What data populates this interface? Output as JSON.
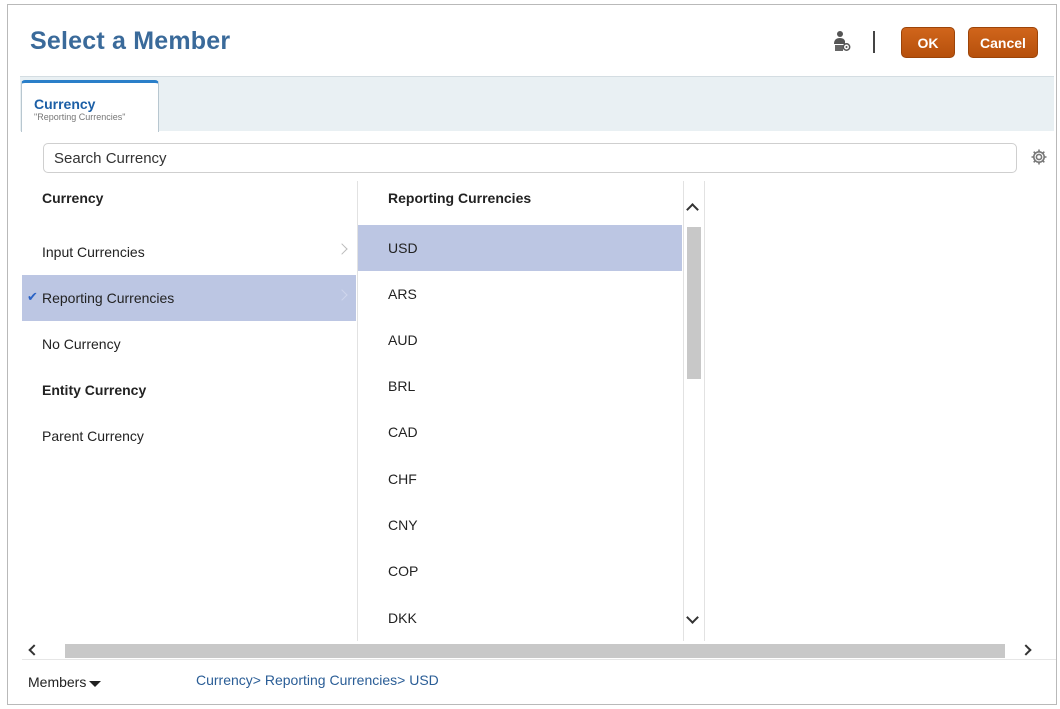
{
  "dialog": {
    "title": "Select a Member",
    "ok_label": "OK",
    "cancel_label": "Cancel",
    "accent_color": "#c95d14"
  },
  "tab": {
    "title": "Currency",
    "subtitle": "\"Reporting Currencies\""
  },
  "search": {
    "placeholder": "Search Currency"
  },
  "column1": {
    "header": "Currency",
    "items": [
      {
        "label": "Input Currencies",
        "bold": false,
        "has_children": true,
        "selected": false
      },
      {
        "label": "Reporting Currencies",
        "bold": false,
        "has_children": true,
        "selected": true,
        "checked": true
      },
      {
        "label": "No Currency",
        "bold": false,
        "has_children": false,
        "selected": false
      },
      {
        "label": "Entity Currency",
        "bold": true,
        "has_children": false,
        "selected": false
      },
      {
        "label": "Parent Currency",
        "bold": false,
        "has_children": false,
        "selected": false
      }
    ]
  },
  "column2": {
    "header": "Reporting Currencies",
    "items": [
      {
        "label": "USD",
        "selected": true
      },
      {
        "label": "ARS",
        "selected": false
      },
      {
        "label": "AUD",
        "selected": false
      },
      {
        "label": "BRL",
        "selected": false
      },
      {
        "label": "CAD",
        "selected": false
      },
      {
        "label": "CHF",
        "selected": false
      },
      {
        "label": "CNY",
        "selected": false
      },
      {
        "label": "COP",
        "selected": false
      },
      {
        "label": "DKK",
        "selected": false
      }
    ]
  },
  "footer": {
    "members_label": "Members",
    "breadcrumb": [
      "Currency>",
      "Reporting Currencies>",
      "USD"
    ]
  },
  "icons": {
    "header_user": "user-settings-icon",
    "search_settings": "gear-icon",
    "check": "checkmark-icon"
  }
}
